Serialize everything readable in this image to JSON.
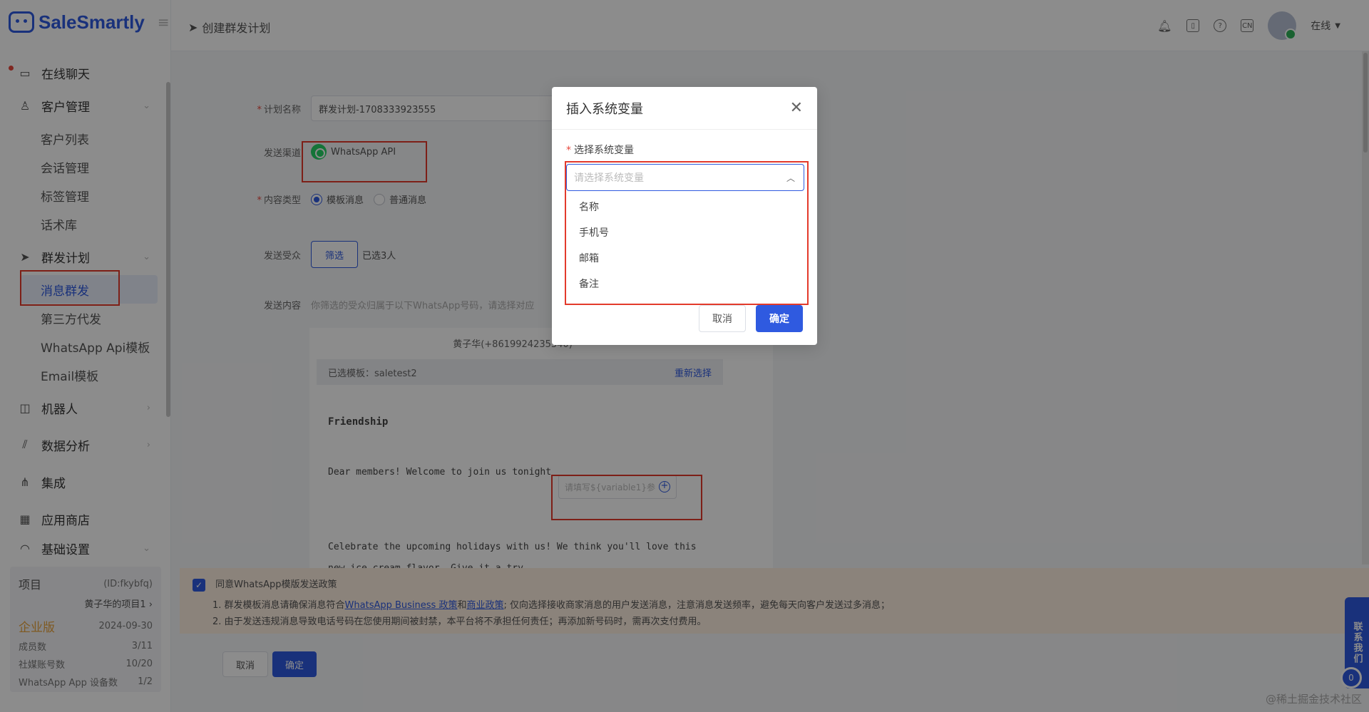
{
  "app": {
    "logo_text": "SaleSmartly"
  },
  "sidebar": {
    "live_chat": "在线聊天",
    "customer_mgmt": "客户管理",
    "customer_subitems": [
      "客户列表",
      "会话管理",
      "标签管理",
      "话术库"
    ],
    "broadcast": "群发计划",
    "broadcast_subitems": [
      "消息群发",
      "第三方代发",
      "WhatsApp Api模板",
      "Email模板"
    ],
    "robot": "机器人",
    "analytics": "数据分析",
    "integration": "集成",
    "app_store": "应用商店",
    "settings": "基础设置"
  },
  "project": {
    "label": "项目",
    "id": "(ID:fkybfq)",
    "name": "黄子华的项目1",
    "edition": "企业版",
    "expiry": "2024-09-30",
    "stats": [
      {
        "label": "成员数",
        "value": "3/11"
      },
      {
        "label": "社媒账号数",
        "value": "10/20"
      },
      {
        "label": "WhatsApp App 设备数",
        "value": "1/2"
      }
    ]
  },
  "header": {
    "page_title": "创建群发计划",
    "status": "在线"
  },
  "form": {
    "plan_name_label": "计划名称",
    "plan_name_value": "群发计划-1708333923555",
    "channel_label": "发送渠道",
    "channel_value": "WhatsApp API",
    "content_type_label": "内容类型",
    "content_type_options": [
      "模板消息",
      "普通消息"
    ],
    "audience_label": "发送受众",
    "filter_btn": "筛选",
    "selected_count": "已选3人",
    "content_label": "发送内容",
    "content_hint": "你筛选的受众归属于以下WhatsApp号码，请选择对应"
  },
  "content_panel": {
    "phone": "黄子华(+8619924235340)",
    "selected_template_label": "已选模板：",
    "selected_template": "saletest2",
    "reselect": "重新选择",
    "heading": "Friendship",
    "line1": "Dear members! Welcome to join us tonight",
    "var_placeholder": "请填写${variable1}参",
    "line2": "Celebrate the upcoming holidays with us! We think you'll love this",
    "line3": "new ice cream flavor. Give it a try"
  },
  "policy": {
    "agree": "同意WhatsApp模版发送政策",
    "line1_pre": "1. 群发模板消息请确保消息符合",
    "link1": "WhatsApp Business 政策",
    "and": "和",
    "link2": "商业政策",
    "line1_post": "; 仅向选择接收商家消息的用户发送消息，注意消息发送频率，避免每天向客户发送过多消息；",
    "line2": "2. 由于发送违规消息导致电话号码在您使用期间被封禁，本平台将不承担任何责任；再添加新号码时，需再次支付费用。"
  },
  "bottom": {
    "cancel": "取消",
    "confirm": "确定"
  },
  "contact": {
    "label": "联系我们",
    "badge": "0"
  },
  "watermark": "@稀土掘金技术社区",
  "modal": {
    "title": "插入系统变量",
    "field_label": "选择系统变量",
    "placeholder": "请选择系统变量",
    "options": [
      "名称",
      "手机号",
      "邮箱",
      "备注"
    ],
    "cancel": "取消",
    "confirm": "确定"
  },
  "colors": {
    "primary": "#2f5ae0",
    "annotation_red": "#e33a2b",
    "policy_bg": "#fdeee0",
    "edition": "#e8a33d"
  }
}
